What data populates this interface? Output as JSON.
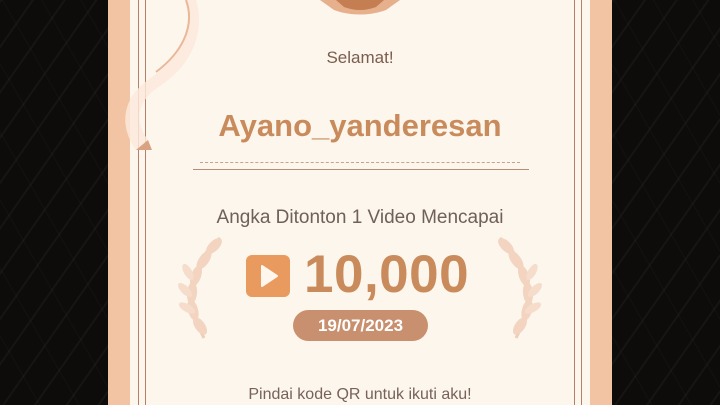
{
  "certificate": {
    "greeting": "Selamat!",
    "username": "Ayano_yanderesan",
    "achievement_text": "Angka Ditonton 1 Video Mencapai",
    "view_count": "10,000",
    "date": "19/07/2023",
    "scan_text": "Pindai kode QR untuk ikuti aku!"
  },
  "colors": {
    "accent": "#c98b5c",
    "play_icon_bg": "#e89a5f",
    "date_badge_bg": "#c8906e",
    "paper": "#fcf6ec",
    "border": "#f2c4a4"
  },
  "icons": {
    "play": "play-icon",
    "laurel_left": "laurel-left-icon",
    "laurel_right": "laurel-right-icon",
    "ribbon": "ribbon-icon"
  }
}
